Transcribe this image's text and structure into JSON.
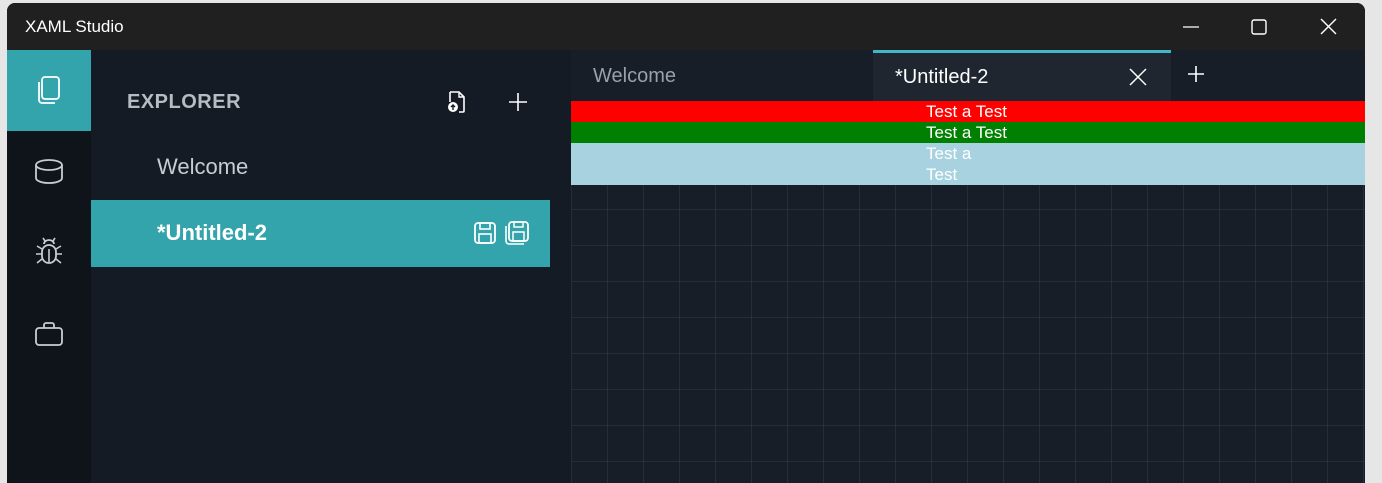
{
  "window": {
    "title": "XAML Studio"
  },
  "titlebar_buttons": [
    "minimize-icon",
    "maximize-icon",
    "close-icon"
  ],
  "activity_bar": {
    "items": [
      {
        "icon": "documents-icon",
        "active": true
      },
      {
        "icon": "database-icon",
        "active": false
      },
      {
        "icon": "bug-icon",
        "active": false
      },
      {
        "icon": "toolbox-icon",
        "active": false
      }
    ]
  },
  "explorer": {
    "header": "EXPLORER",
    "header_actions": [
      "open-file-icon",
      "add-icon"
    ],
    "files": [
      {
        "label": "Welcome",
        "selected": false
      },
      {
        "label": "*Untitled-2",
        "selected": true,
        "actions": [
          "save-icon",
          "save-all-icon"
        ]
      }
    ]
  },
  "editor": {
    "tabs": [
      {
        "label": "Welcome",
        "active": false
      },
      {
        "label": "*Untitled-2",
        "active": true
      }
    ],
    "preview": {
      "rows": [
        {
          "text": "Test a Test",
          "background": "#ff0000"
        },
        {
          "text": "Test a Test",
          "background": "#008000"
        },
        {
          "text": "Test a Test",
          "background": "#add8e6"
        }
      ]
    }
  },
  "colors": {
    "accent": "#33a4ab",
    "tab_indicator": "#42b6c8",
    "background": "#151b24"
  }
}
